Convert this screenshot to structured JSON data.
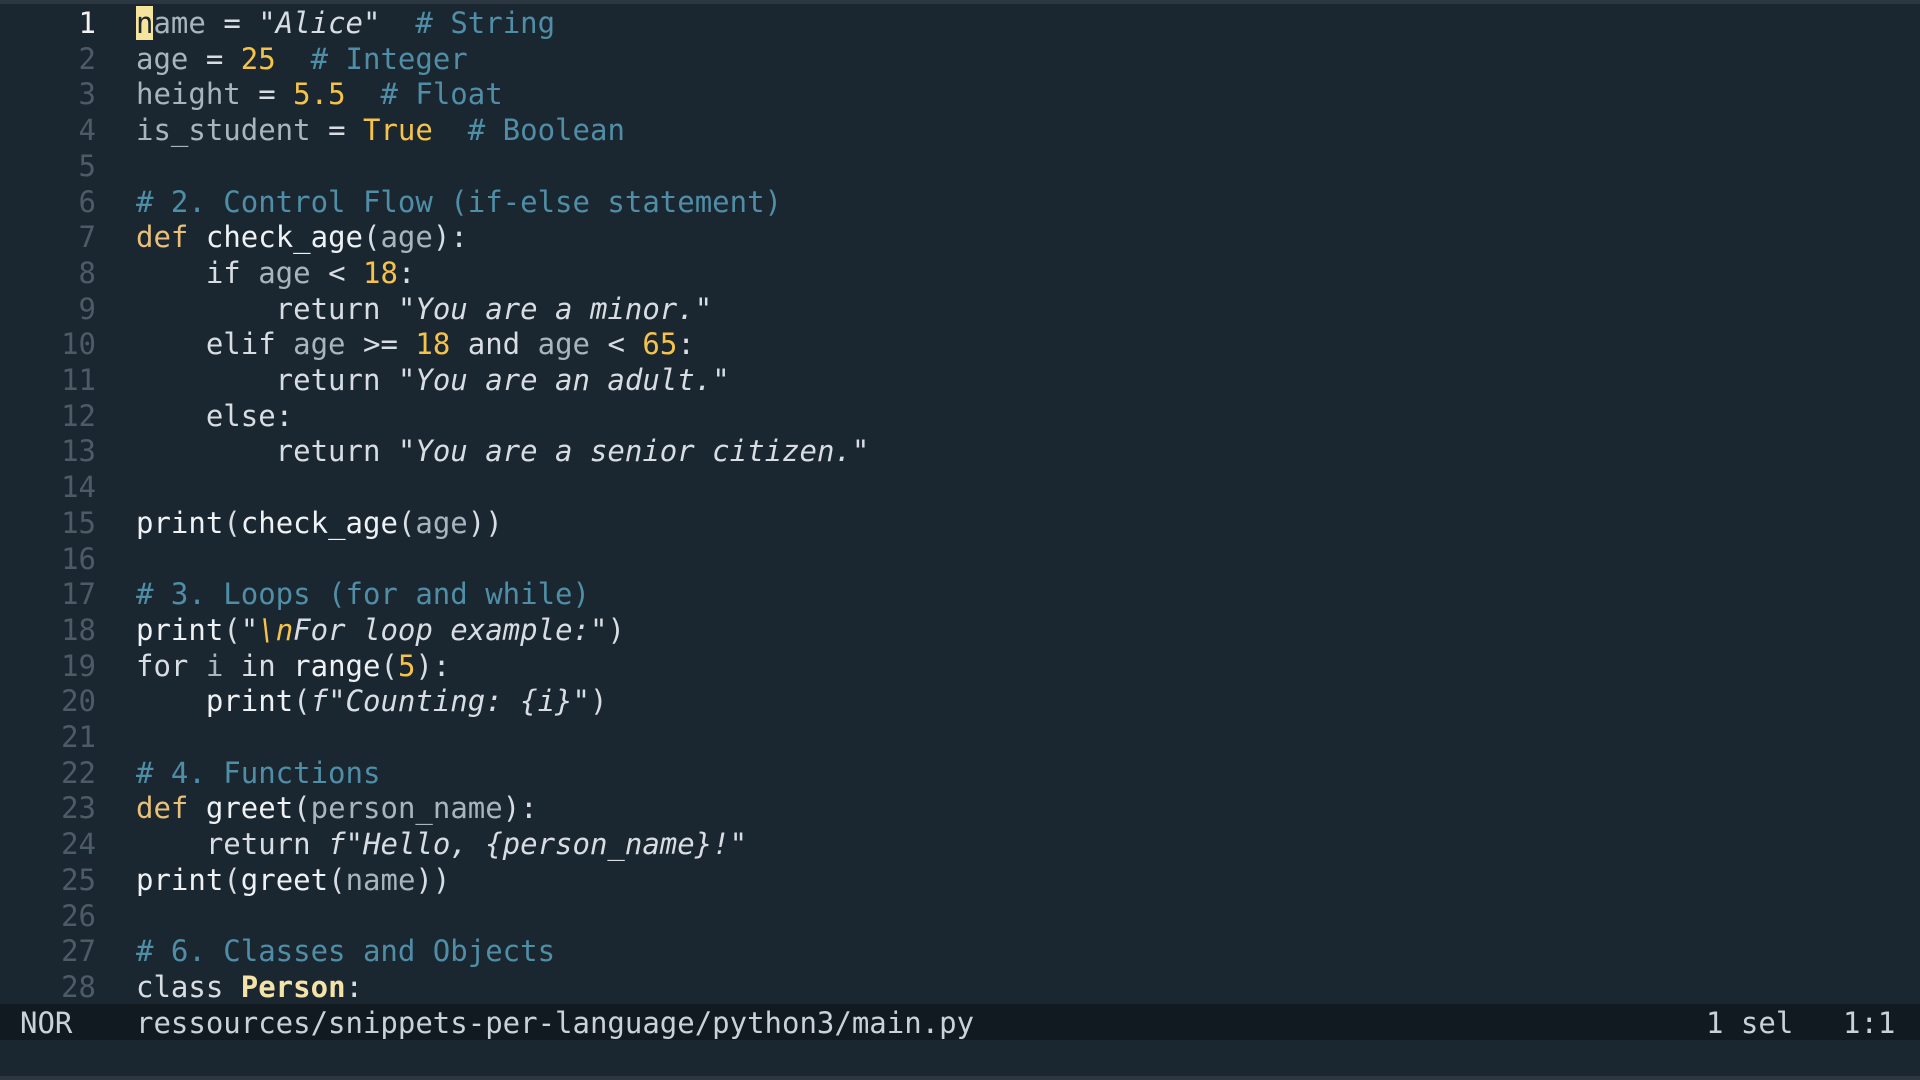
{
  "editor": {
    "cursor_line": 1,
    "lines": [
      {
        "n": "1",
        "tokens": [
          {
            "t": "n",
            "c": "cursor"
          },
          {
            "t": "ame",
            "c": "var"
          },
          {
            "t": " = ",
            "c": "plain"
          },
          {
            "t": "\"",
            "c": "quote"
          },
          {
            "t": "Alice",
            "c": "string"
          },
          {
            "t": "\"",
            "c": "quote"
          },
          {
            "t": "  # String",
            "c": "comment"
          }
        ]
      },
      {
        "n": "2",
        "tokens": [
          {
            "t": "age",
            "c": "var"
          },
          {
            "t": " = ",
            "c": "plain"
          },
          {
            "t": "25",
            "c": "number"
          },
          {
            "t": "  # Integer",
            "c": "comment"
          }
        ]
      },
      {
        "n": "3",
        "tokens": [
          {
            "t": "height",
            "c": "var"
          },
          {
            "t": " = ",
            "c": "plain"
          },
          {
            "t": "5.5",
            "c": "number"
          },
          {
            "t": "  # Float",
            "c": "comment"
          }
        ]
      },
      {
        "n": "4",
        "tokens": [
          {
            "t": "is_student",
            "c": "var"
          },
          {
            "t": " = ",
            "c": "plain"
          },
          {
            "t": "True",
            "c": "constant"
          },
          {
            "t": "  # Boolean",
            "c": "comment"
          }
        ]
      },
      {
        "n": "5",
        "tokens": []
      },
      {
        "n": "6",
        "tokens": [
          {
            "t": "# 2. Control Flow (if-else statement)",
            "c": "comment"
          }
        ]
      },
      {
        "n": "7",
        "tokens": [
          {
            "t": "def",
            "c": "keyword"
          },
          {
            "t": " ",
            "c": "plain"
          },
          {
            "t": "check_age",
            "c": "func"
          },
          {
            "t": "(",
            "c": "plain"
          },
          {
            "t": "age",
            "c": "var"
          },
          {
            "t": "):",
            "c": "plain"
          }
        ]
      },
      {
        "n": "8",
        "tokens": [
          {
            "t": "    if ",
            "c": "plain"
          },
          {
            "t": "age",
            "c": "var"
          },
          {
            "t": " < ",
            "c": "plain"
          },
          {
            "t": "18",
            "c": "number"
          },
          {
            "t": ":",
            "c": "plain"
          }
        ]
      },
      {
        "n": "9",
        "tokens": [
          {
            "t": "        return ",
            "c": "plain"
          },
          {
            "t": "\"",
            "c": "quote"
          },
          {
            "t": "You are a minor.",
            "c": "string"
          },
          {
            "t": "\"",
            "c": "quote"
          }
        ]
      },
      {
        "n": "10",
        "tokens": [
          {
            "t": "    elif ",
            "c": "plain"
          },
          {
            "t": "age",
            "c": "var"
          },
          {
            "t": " >= ",
            "c": "plain"
          },
          {
            "t": "18",
            "c": "number"
          },
          {
            "t": " and ",
            "c": "plain"
          },
          {
            "t": "age",
            "c": "var"
          },
          {
            "t": " < ",
            "c": "plain"
          },
          {
            "t": "65",
            "c": "number"
          },
          {
            "t": ":",
            "c": "plain"
          }
        ]
      },
      {
        "n": "11",
        "tokens": [
          {
            "t": "        return ",
            "c": "plain"
          },
          {
            "t": "\"",
            "c": "quote"
          },
          {
            "t": "You are an adult.",
            "c": "string"
          },
          {
            "t": "\"",
            "c": "quote"
          }
        ]
      },
      {
        "n": "12",
        "tokens": [
          {
            "t": "    else:",
            "c": "plain"
          }
        ]
      },
      {
        "n": "13",
        "tokens": [
          {
            "t": "        return ",
            "c": "plain"
          },
          {
            "t": "\"",
            "c": "quote"
          },
          {
            "t": "You are a senior citizen.",
            "c": "string"
          },
          {
            "t": "\"",
            "c": "quote"
          }
        ]
      },
      {
        "n": "14",
        "tokens": []
      },
      {
        "n": "15",
        "tokens": [
          {
            "t": "print",
            "c": "func"
          },
          {
            "t": "(",
            "c": "plain"
          },
          {
            "t": "check_age",
            "c": "func"
          },
          {
            "t": "(",
            "c": "plain"
          },
          {
            "t": "age",
            "c": "var"
          },
          {
            "t": "))",
            "c": "plain"
          }
        ]
      },
      {
        "n": "16",
        "tokens": []
      },
      {
        "n": "17",
        "tokens": [
          {
            "t": "# 3. Loops (for and while)",
            "c": "comment"
          }
        ]
      },
      {
        "n": "18",
        "tokens": [
          {
            "t": "print",
            "c": "func"
          },
          {
            "t": "(",
            "c": "plain"
          },
          {
            "t": "\"",
            "c": "quote"
          },
          {
            "t": "\\n",
            "c": "escape"
          },
          {
            "t": "For loop example:",
            "c": "string"
          },
          {
            "t": "\"",
            "c": "quote"
          },
          {
            "t": ")",
            "c": "plain"
          }
        ]
      },
      {
        "n": "19",
        "tokens": [
          {
            "t": "for ",
            "c": "plain"
          },
          {
            "t": "i",
            "c": "var"
          },
          {
            "t": " in ",
            "c": "plain"
          },
          {
            "t": "range",
            "c": "func"
          },
          {
            "t": "(",
            "c": "plain"
          },
          {
            "t": "5",
            "c": "number"
          },
          {
            "t": "):",
            "c": "plain"
          }
        ]
      },
      {
        "n": "20",
        "tokens": [
          {
            "t": "    print",
            "c": "func"
          },
          {
            "t": "(",
            "c": "plain"
          },
          {
            "t": "f",
            "c": "fprefix"
          },
          {
            "t": "\"",
            "c": "quote"
          },
          {
            "t": "Counting: {i}",
            "c": "string"
          },
          {
            "t": "\"",
            "c": "quote"
          },
          {
            "t": ")",
            "c": "plain"
          }
        ]
      },
      {
        "n": "21",
        "tokens": []
      },
      {
        "n": "22",
        "tokens": [
          {
            "t": "# 4. Functions",
            "c": "comment"
          }
        ]
      },
      {
        "n": "23",
        "tokens": [
          {
            "t": "def",
            "c": "keyword"
          },
          {
            "t": " ",
            "c": "plain"
          },
          {
            "t": "greet",
            "c": "func"
          },
          {
            "t": "(",
            "c": "plain"
          },
          {
            "t": "person_name",
            "c": "var"
          },
          {
            "t": "):",
            "c": "plain"
          }
        ]
      },
      {
        "n": "24",
        "tokens": [
          {
            "t": "    return ",
            "c": "plain"
          },
          {
            "t": "f",
            "c": "fprefix"
          },
          {
            "t": "\"",
            "c": "quote"
          },
          {
            "t": "Hello, {person_name}!",
            "c": "string"
          },
          {
            "t": "\"",
            "c": "quote"
          }
        ]
      },
      {
        "n": "25",
        "tokens": [
          {
            "t": "print",
            "c": "func"
          },
          {
            "t": "(",
            "c": "plain"
          },
          {
            "t": "greet",
            "c": "func"
          },
          {
            "t": "(",
            "c": "plain"
          },
          {
            "t": "name",
            "c": "var"
          },
          {
            "t": "))",
            "c": "plain"
          }
        ]
      },
      {
        "n": "26",
        "tokens": []
      },
      {
        "n": "27",
        "tokens": [
          {
            "t": "# 6. Classes and Objects",
            "c": "comment"
          }
        ]
      },
      {
        "n": "28",
        "tokens": [
          {
            "t": "class ",
            "c": "plain"
          },
          {
            "t": "Person",
            "c": "classname"
          },
          {
            "t": ":",
            "c": "plain"
          }
        ]
      }
    ]
  },
  "statusbar": {
    "mode": "NOR",
    "file_path": "ressources/snippets-per-language/python3/main.py",
    "selections": "1 sel",
    "position": "1:1"
  },
  "colors": {
    "background": "#1b2730",
    "statusbar": "#111a20",
    "keyword": "#e8c07a",
    "number": "#f6c34a",
    "comment": "#4f8ea6",
    "cursor": "#f6e49a"
  }
}
